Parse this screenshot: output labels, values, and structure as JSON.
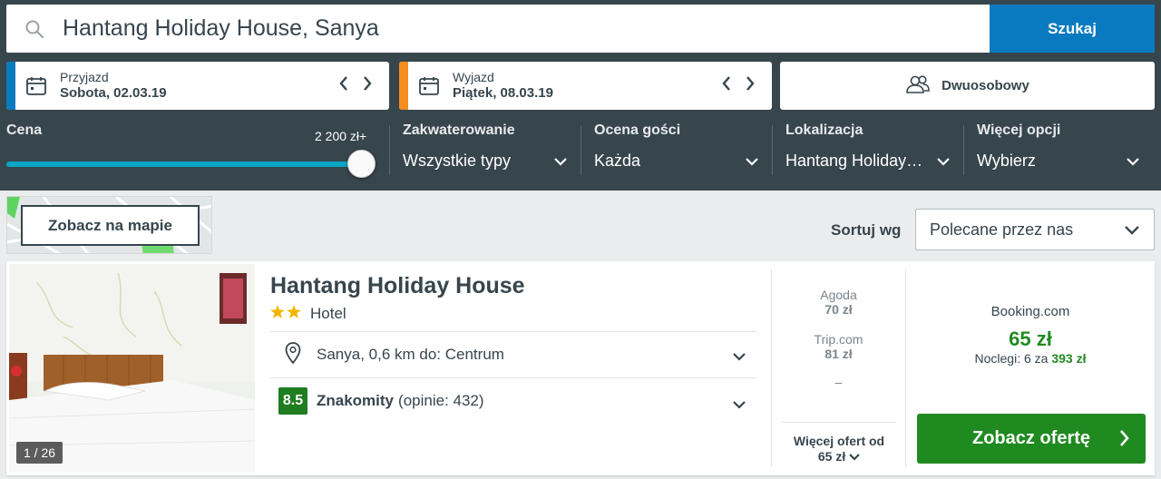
{
  "search": {
    "value": "Hantang Holiday House, Sanya",
    "button": "Szukaj"
  },
  "dates": {
    "checkin": {
      "label": "Przyjazd",
      "value": "Sobota, 02.03.19",
      "color": "#0a7ac0"
    },
    "checkout": {
      "label": "Wyjazd",
      "value": "Piątek, 08.03.19",
      "color": "#f68d1e"
    }
  },
  "room": {
    "label": "Dwuosobowy"
  },
  "filters": {
    "price": {
      "title": "Cena",
      "max": "2 200 zł+",
      "fill": 1.0
    },
    "accommodation": {
      "title": "Zakwaterowanie",
      "value": "Wszystkie typy"
    },
    "rating": {
      "title": "Ocena gości",
      "value": "Każda"
    },
    "location": {
      "title": "Lokalizacja",
      "value": "Hantang Holiday…"
    },
    "more": {
      "title": "Więcej opcji",
      "value": "Wybierz"
    }
  },
  "map": {
    "button": "Zobacz na mapie"
  },
  "sort": {
    "label": "Sortuj wg",
    "value": "Polecane przez nas"
  },
  "hotel": {
    "name": "Hantang Holiday House",
    "stars": 2,
    "type": "Hotel",
    "photo_counter": "1 / 26",
    "location": "Sanya, 0,6 km do: Centrum",
    "rating_score": "8.5",
    "rating_text": "Znakomity",
    "rating_reviews": "(opinie: 432)"
  },
  "partners": [
    {
      "name": "Agoda",
      "price": "70 zł"
    },
    {
      "name": "Trip.com",
      "price": "81 zł"
    },
    {
      "name": "–",
      "price": ""
    }
  ],
  "more_offers": {
    "line1": "Więcej ofert od",
    "line2": "65 zł"
  },
  "best_offer": {
    "provider": "Booking.com",
    "price": "65 zł",
    "nights_label": "Noclegi: 6 za",
    "nights_total": "393 zł",
    "button": "Zobacz ofertę"
  },
  "colors": {
    "accent_blue": "#0a7ac0",
    "accent_green": "#1f8a1f",
    "dark": "#37454d"
  }
}
